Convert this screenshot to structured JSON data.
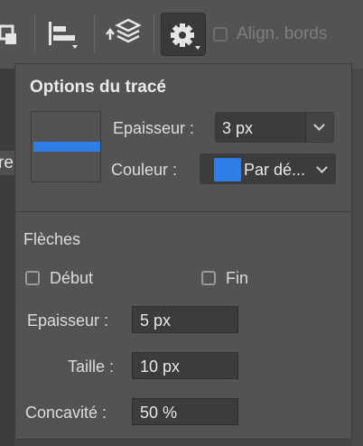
{
  "toolbar": {
    "left_fragment_icon": "transform-icon",
    "align_icon": "align-left-icon",
    "distribute_icon": "layer-stack-arrange-icon",
    "settings_icon": "gear-icon",
    "align_edges_label": "Align. bords",
    "align_edges_checked": false
  },
  "background": {
    "left_fragment_text": "re"
  },
  "stroke_options": {
    "title": "Options du tracé",
    "preview_color": "#2f7ee8",
    "weight_label": "Epaisseur :",
    "weight_value": "3 px",
    "color_label": "Couleur :",
    "color_value": "Par dé...",
    "color_swatch": "#2f7ee8"
  },
  "arrows": {
    "section_label": "Flèches",
    "start_label": "Début",
    "start_checked": false,
    "end_label": "Fin",
    "end_checked": false,
    "weight_label": "Epaisseur :",
    "weight_value": "5 px",
    "size_label": "Taille :",
    "size_value": "10 px",
    "concavity_label": "Concavité :",
    "concavity_value": "50 %"
  }
}
